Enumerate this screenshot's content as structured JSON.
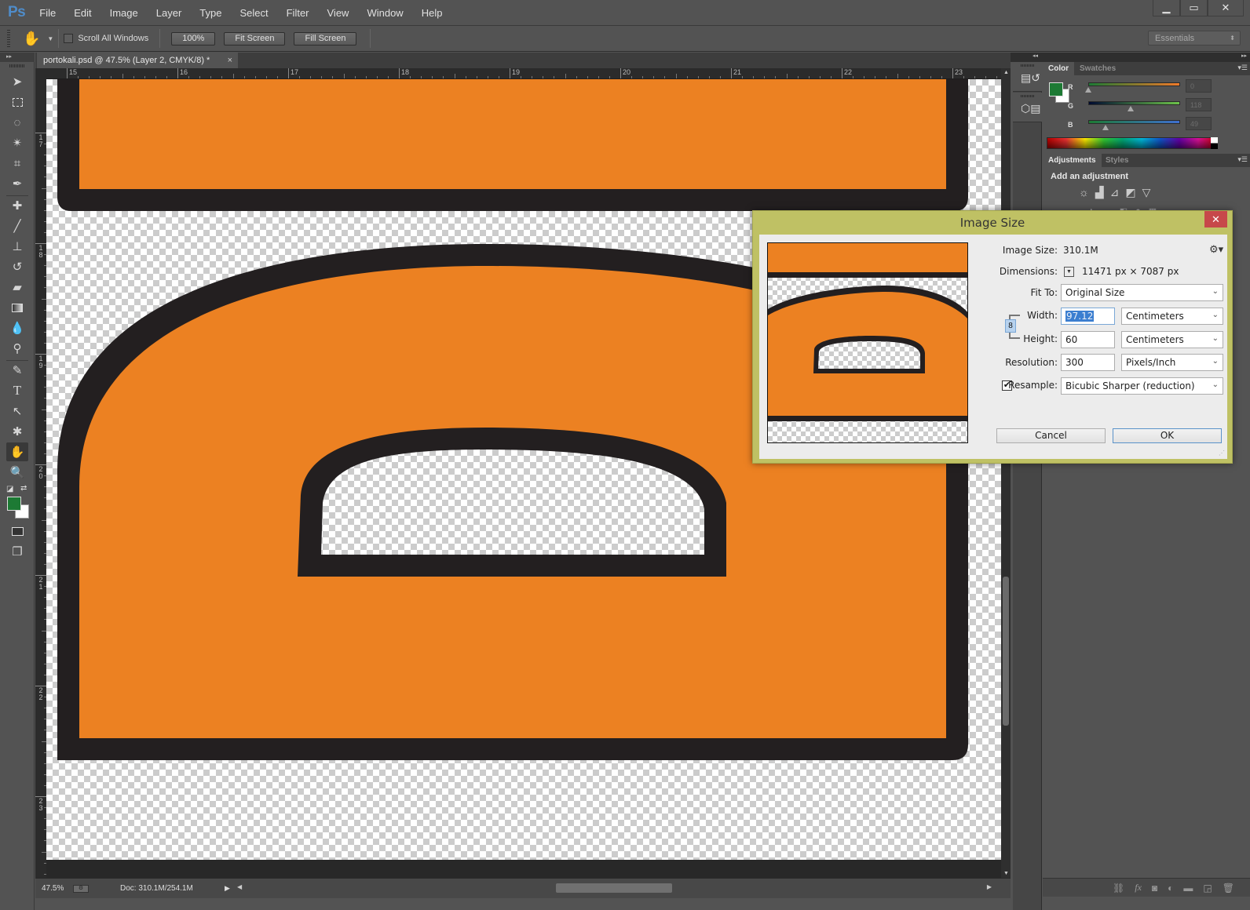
{
  "app": {
    "logo": "Ps",
    "menu": [
      "File",
      "Edit",
      "Image",
      "Layer",
      "Type",
      "Select",
      "Filter",
      "View",
      "Window",
      "Help"
    ],
    "window_controls": {
      "minimize": "▁",
      "maximize": "▭",
      "close": "✕"
    }
  },
  "options_bar": {
    "scroll_all_windows_label": "Scroll All Windows",
    "scroll_all_windows_checked": false,
    "btn_100": "100%",
    "btn_fit": "Fit Screen",
    "btn_fill": "Fill Screen",
    "workspace": "Essentials"
  },
  "document": {
    "tab_title": "portokali.psd @ 47.5% (Layer 2, CMYK/8) *",
    "tab_close": "×",
    "ruler_top": [
      "15",
      "16",
      "17",
      "18",
      "19",
      "20",
      "21",
      "22",
      "23"
    ],
    "ruler_left": [
      "17",
      "18",
      "19",
      "20",
      "21",
      "22",
      "23"
    ],
    "colors": {
      "orange": "#ec8122",
      "outline": "#231f20"
    }
  },
  "status": {
    "zoom": "47.5%",
    "doc_info": "Doc: 310.1M/254.1M"
  },
  "tools": [
    "move-tool",
    "marquee-tool",
    "lasso-tool",
    "magic-wand-tool",
    "crop-tool",
    "eyedropper-tool",
    "healing-brush-tool",
    "brush-tool",
    "clone-stamp-tool",
    "history-brush-tool",
    "eraser-tool",
    "gradient-tool",
    "blur-tool",
    "dodge-tool",
    "pen-tool",
    "type-tool",
    "path-selection-tool",
    "custom-shape-tool",
    "hand-tool",
    "zoom-tool"
  ],
  "swatches": {
    "foreground": "#1d7a34",
    "background": "#ffffff"
  },
  "color_panel": {
    "tabs": [
      "Color",
      "Swatches"
    ],
    "active_tab": "Color",
    "channels": [
      {
        "label": "R",
        "value": "0",
        "level": 0.0
      },
      {
        "label": "G",
        "value": "118",
        "level": 0.4627
      },
      {
        "label": "B",
        "value": "49",
        "level": 0.1922
      }
    ]
  },
  "adjustments_panel": {
    "tabs": [
      "Adjustments",
      "Styles"
    ],
    "active_tab": "Adjustments",
    "title": "Add an adjustment"
  },
  "dialog": {
    "title": "Image Size",
    "close": "✕",
    "image_size_label": "Image Size:",
    "image_size_value": "310.1M",
    "dimensions_label": "Dimensions:",
    "dimensions_value": "11471 px  ×  7087 px",
    "fit_to_label": "Fit To:",
    "fit_to_value": "Original Size",
    "width_label": "Width:",
    "width_value": "97.12",
    "width_unit": "Centimeters",
    "height_label": "Height:",
    "height_value": "60",
    "height_unit": "Centimeters",
    "resolution_label": "Resolution:",
    "resolution_value": "300",
    "resolution_unit": "Pixels/Inch",
    "resample_label": "Resample:",
    "resample_checked": true,
    "resample_value": "Bicubic Sharper (reduction)",
    "cancel": "Cancel",
    "ok": "OK"
  }
}
